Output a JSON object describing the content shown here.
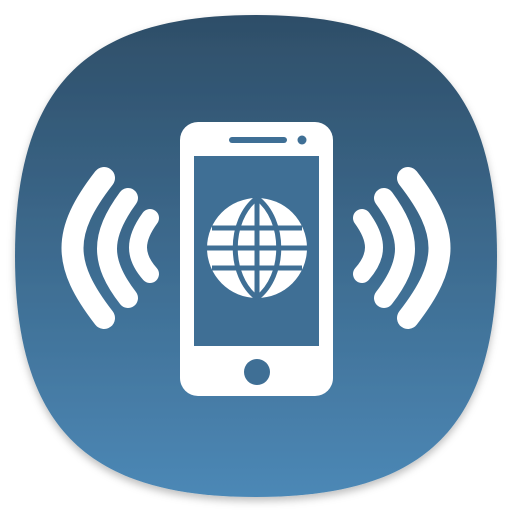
{
  "app_icon": {
    "name": "phone-signal-globe-icon",
    "colors": {
      "background_top": "#2E4E68",
      "background_bottom": "#4C88B6",
      "foreground": "#FFFFFF"
    }
  }
}
